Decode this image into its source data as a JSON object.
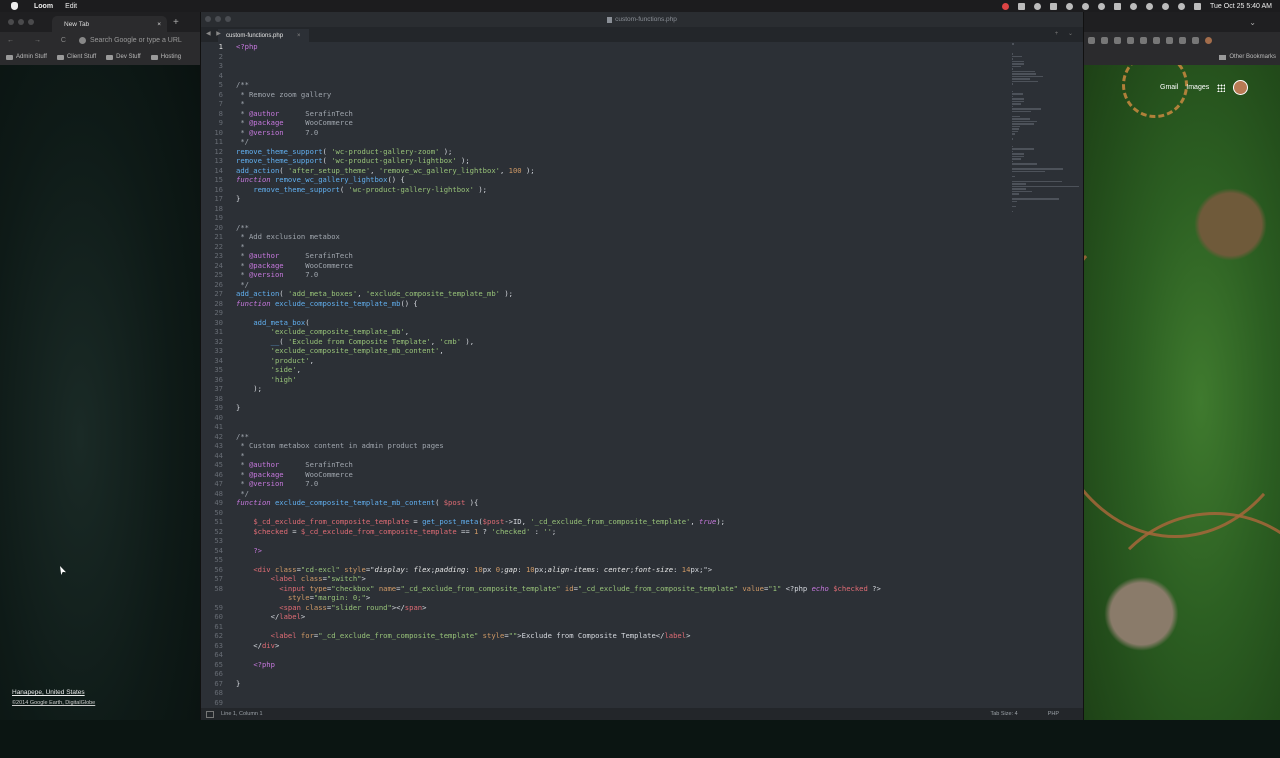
{
  "menubar": {
    "app_name": "Loom",
    "menu_edit": "Edit",
    "clock": "Tue Oct 25  5:40 AM"
  },
  "browser": {
    "tab_title": "New Tab",
    "tab_close": "×",
    "new_tab": "+",
    "nav_icons": "← → C",
    "address_placeholder": "Search Google or type a URL",
    "bookmarks": [
      "Admin Stuff",
      "Client Stuff",
      "Dev Stuff",
      "Hosting"
    ],
    "other_bookmarks": "Other Bookmarks",
    "google_links": {
      "gmail": "Gmail",
      "images": "Images"
    }
  },
  "wallpaper": {
    "location": "Hanapepe, United States",
    "copyright": "©2014 Google Earth, DigitalGlobe"
  },
  "editor": {
    "window_title": "custom-functions.php",
    "tab_label": "custom-functions.php",
    "tab_close": "×",
    "tab_arrows": "◀ ▶",
    "status_position": "Line 1, Column 1",
    "status_tab_size": "Tab Size: 4",
    "status_language": "PHP",
    "active_line": 1
  },
  "code_lines": [
    [
      [
        "tag",
        "<?php"
      ]
    ],
    [],
    [],
    [],
    [
      [
        "com",
        "/**"
      ]
    ],
    [
      [
        "com",
        " * Remove zoom gallery"
      ]
    ],
    [
      [
        "com",
        " *"
      ]
    ],
    [
      [
        "com",
        " * "
      ],
      [
        "tag",
        "@author"
      ],
      [
        "com",
        "      SerafinTech"
      ]
    ],
    [
      [
        "com",
        " * "
      ],
      [
        "tag",
        "@package"
      ],
      [
        "com",
        "     WooCommerce"
      ]
    ],
    [
      [
        "com",
        " * "
      ],
      [
        "tag",
        "@version"
      ],
      [
        "com",
        "     7.0"
      ]
    ],
    [
      [
        "com",
        " */"
      ]
    ],
    [
      [
        "fn",
        "remove_theme_support"
      ],
      [
        "txt",
        "( "
      ],
      [
        "str",
        "'wc-product-gallery-zoom'"
      ],
      [
        "txt",
        " );"
      ]
    ],
    [
      [
        "fn",
        "remove_theme_support"
      ],
      [
        "txt",
        "( "
      ],
      [
        "str",
        "'wc-product-gallery-lightbox'"
      ],
      [
        "txt",
        " );"
      ]
    ],
    [
      [
        "fn",
        "add_action"
      ],
      [
        "txt",
        "( "
      ],
      [
        "str",
        "'after_setup_theme'"
      ],
      [
        "txt",
        ", "
      ],
      [
        "str",
        "'remove_wc_gallery_lightbox'"
      ],
      [
        "txt",
        ", "
      ],
      [
        "num",
        "100"
      ],
      [
        "txt",
        " );"
      ]
    ],
    [
      [
        "kw",
        "function"
      ],
      [
        "txt",
        " "
      ],
      [
        "fn",
        "remove_wc_gallery_lightbox"
      ],
      [
        "txt",
        "() {"
      ]
    ],
    [
      [
        "txt",
        "    "
      ],
      [
        "fn",
        "remove_theme_support"
      ],
      [
        "txt",
        "( "
      ],
      [
        "str",
        "'wc-product-gallery-lightbox'"
      ],
      [
        "txt",
        " );"
      ]
    ],
    [
      [
        "txt",
        "}"
      ]
    ],
    [],
    [],
    [
      [
        "com",
        "/**"
      ]
    ],
    [
      [
        "com",
        " * Add exclusion metabox"
      ]
    ],
    [
      [
        "com",
        " *"
      ]
    ],
    [
      [
        "com",
        " * "
      ],
      [
        "tag",
        "@author"
      ],
      [
        "com",
        "      SerafinTech"
      ]
    ],
    [
      [
        "com",
        " * "
      ],
      [
        "tag",
        "@package"
      ],
      [
        "com",
        "     WooCommerce"
      ]
    ],
    [
      [
        "com",
        " * "
      ],
      [
        "tag",
        "@version"
      ],
      [
        "com",
        "     7.0"
      ]
    ],
    [
      [
        "com",
        " */"
      ]
    ],
    [
      [
        "fn",
        "add_action"
      ],
      [
        "txt",
        "( "
      ],
      [
        "str",
        "'add_meta_boxes'"
      ],
      [
        "txt",
        ", "
      ],
      [
        "str",
        "'exclude_composite_template_mb'"
      ],
      [
        "txt",
        " );"
      ]
    ],
    [
      [
        "kw",
        "function"
      ],
      [
        "txt",
        " "
      ],
      [
        "fn",
        "exclude_composite_template_mb"
      ],
      [
        "txt",
        "() {"
      ]
    ],
    [],
    [
      [
        "txt",
        "    "
      ],
      [
        "fn",
        "add_meta_box"
      ],
      [
        "txt",
        "("
      ]
    ],
    [
      [
        "txt",
        "        "
      ],
      [
        "str",
        "'exclude_composite_template_mb'"
      ],
      [
        "txt",
        ","
      ]
    ],
    [
      [
        "txt",
        "        "
      ],
      [
        "fn",
        "__"
      ],
      [
        "txt",
        "( "
      ],
      [
        "str",
        "'Exclude from Composite Template'"
      ],
      [
        "txt",
        ", "
      ],
      [
        "str",
        "'cmb'"
      ],
      [
        "txt",
        " ),"
      ]
    ],
    [
      [
        "txt",
        "        "
      ],
      [
        "str",
        "'exclude_composite_template_mb_content'"
      ],
      [
        "txt",
        ","
      ]
    ],
    [
      [
        "txt",
        "        "
      ],
      [
        "str",
        "'product'"
      ],
      [
        "txt",
        ","
      ]
    ],
    [
      [
        "txt",
        "        "
      ],
      [
        "str",
        "'side'"
      ],
      [
        "txt",
        ","
      ]
    ],
    [
      [
        "txt",
        "        "
      ],
      [
        "str",
        "'high'"
      ]
    ],
    [
      [
        "txt",
        "    );"
      ]
    ],
    [],
    [
      [
        "txt",
        "}"
      ]
    ],
    [],
    [],
    [
      [
        "com",
        "/**"
      ]
    ],
    [
      [
        "com",
        " * Custom metabox content in admin product pages"
      ]
    ],
    [
      [
        "com",
        " *"
      ]
    ],
    [
      [
        "com",
        " * "
      ],
      [
        "tag",
        "@author"
      ],
      [
        "com",
        "      SerafinTech"
      ]
    ],
    [
      [
        "com",
        " * "
      ],
      [
        "tag",
        "@package"
      ],
      [
        "com",
        "     WooCommerce"
      ]
    ],
    [
      [
        "com",
        " * "
      ],
      [
        "tag",
        "@version"
      ],
      [
        "com",
        "     7.0"
      ]
    ],
    [
      [
        "com",
        " */"
      ]
    ],
    [
      [
        "kw",
        "function"
      ],
      [
        "txt",
        " "
      ],
      [
        "fn",
        "exclude_composite_template_mb_content"
      ],
      [
        "txt",
        "( "
      ],
      [
        "var",
        "$post"
      ],
      [
        "txt",
        " ){"
      ]
    ],
    [],
    [
      [
        "txt",
        "    "
      ],
      [
        "var",
        "$_cd_exclude_from_composite_template"
      ],
      [
        "txt",
        " = "
      ],
      [
        "fn",
        "get_post_meta"
      ],
      [
        "txt",
        "("
      ],
      [
        "var",
        "$post"
      ],
      [
        "txt",
        "->ID, "
      ],
      [
        "str",
        "'_cd_exclude_from_composite_template'"
      ],
      [
        "txt",
        ", "
      ],
      [
        "kw",
        "true"
      ],
      [
        "txt",
        ");"
      ]
    ],
    [
      [
        "txt",
        "    "
      ],
      [
        "var",
        "$checked"
      ],
      [
        "txt",
        " = "
      ],
      [
        "var",
        "$_cd_exclude_from_composite_template"
      ],
      [
        "txt",
        " == "
      ],
      [
        "num",
        "1"
      ],
      [
        "txt",
        " ? "
      ],
      [
        "str",
        "'checked'"
      ],
      [
        "txt",
        " : "
      ],
      [
        "str",
        "''"
      ],
      [
        "txt",
        ";"
      ]
    ],
    [],
    [
      [
        "txt",
        "    "
      ],
      [
        "tag",
        "?>"
      ]
    ],
    [],
    [
      [
        "txt",
        "    "
      ],
      [
        "html",
        "<div"
      ],
      [
        "txt",
        " "
      ],
      [
        "attr",
        "class"
      ],
      [
        "txt",
        "="
      ],
      [
        "str",
        "\"cd-excl\""
      ],
      [
        "txt",
        " "
      ],
      [
        "attr",
        "style"
      ],
      [
        "txt",
        "=\""
      ],
      [
        "css",
        "display"
      ],
      [
        "txt",
        ": "
      ],
      [
        "css",
        "flex"
      ],
      [
        "txt",
        ";"
      ],
      [
        "css",
        "padding"
      ],
      [
        "txt",
        ": "
      ],
      [
        "num",
        "10"
      ],
      [
        "txt",
        "px "
      ],
      [
        "num",
        "0"
      ],
      [
        "txt",
        ";"
      ],
      [
        "css",
        "gap"
      ],
      [
        "txt",
        ": "
      ],
      [
        "num",
        "10"
      ],
      [
        "txt",
        "px;"
      ],
      [
        "css",
        "align-items"
      ],
      [
        "txt",
        ": "
      ],
      [
        "css",
        "center"
      ],
      [
        "txt",
        ";"
      ],
      [
        "css",
        "font-size"
      ],
      [
        "txt",
        ": "
      ],
      [
        "num",
        "14"
      ],
      [
        "txt",
        "px;\">"
      ]
    ],
    [
      [
        "txt",
        "        "
      ],
      [
        "html",
        "<label"
      ],
      [
        "txt",
        " "
      ],
      [
        "attr",
        "class"
      ],
      [
        "txt",
        "="
      ],
      [
        "str",
        "\"switch\""
      ],
      [
        "txt",
        ">"
      ]
    ],
    [
      [
        "txt",
        "          "
      ],
      [
        "html",
        "<input"
      ],
      [
        "txt",
        " "
      ],
      [
        "attr",
        "type"
      ],
      [
        "txt",
        "="
      ],
      [
        "str",
        "\"checkbox\""
      ],
      [
        "txt",
        " "
      ],
      [
        "attr",
        "name"
      ],
      [
        "txt",
        "="
      ],
      [
        "str",
        "\"_cd_exclude_from_composite_template\""
      ],
      [
        "txt",
        " "
      ],
      [
        "attr",
        "id"
      ],
      [
        "txt",
        "="
      ],
      [
        "str",
        "\"_cd_exclude_from_composite_template\""
      ],
      [
        "txt",
        " "
      ],
      [
        "attr",
        "value"
      ],
      [
        "txt",
        "="
      ],
      [
        "str",
        "\"1\""
      ],
      [
        "txt",
        " <?php "
      ],
      [
        "kw",
        "echo"
      ],
      [
        "txt",
        " "
      ],
      [
        "var",
        "$checked"
      ],
      [
        "txt",
        " ?>"
      ]
    ],
    [
      [
        "txt",
        "            "
      ],
      [
        "attr",
        "style"
      ],
      [
        "txt",
        "="
      ],
      [
        "str",
        "\"margin: 0;\""
      ],
      [
        "txt",
        ">"
      ]
    ],
    [
      [
        "txt",
        "          "
      ],
      [
        "html",
        "<span"
      ],
      [
        "txt",
        " "
      ],
      [
        "attr",
        "class"
      ],
      [
        "txt",
        "="
      ],
      [
        "str",
        "\"slider round\""
      ],
      [
        "txt",
        "></"
      ],
      [
        "html",
        "span"
      ],
      [
        "txt",
        ">"
      ]
    ],
    [
      [
        "txt",
        "        </"
      ],
      [
        "html",
        "label"
      ],
      [
        "txt",
        ">"
      ]
    ],
    [],
    [
      [
        "txt",
        "        "
      ],
      [
        "html",
        "<label"
      ],
      [
        "txt",
        " "
      ],
      [
        "attr",
        "for"
      ],
      [
        "txt",
        "="
      ],
      [
        "str",
        "\"_cd_exclude_from_composite_template\""
      ],
      [
        "txt",
        " "
      ],
      [
        "attr",
        "style"
      ],
      [
        "txt",
        "="
      ],
      [
        "str",
        "\"\""
      ],
      [
        "txt",
        ">Exclude from Composite Template</"
      ],
      [
        "html",
        "label"
      ],
      [
        "txt",
        ">"
      ]
    ],
    [
      [
        "txt",
        "    </"
      ],
      [
        "html",
        "div"
      ],
      [
        "txt",
        ">"
      ]
    ],
    [],
    [
      [
        "txt",
        "    "
      ],
      [
        "tag",
        "<?php"
      ]
    ],
    [],
    [
      [
        "txt",
        "}"
      ]
    ],
    [],
    []
  ],
  "line_numbers": [
    "1",
    "2",
    "3",
    "4",
    "5",
    "6",
    "7",
    "8",
    "9",
    "10",
    "11",
    "12",
    "13",
    "14",
    "15",
    "16",
    "17",
    "18",
    "19",
    "20",
    "21",
    "22",
    "23",
    "24",
    "25",
    "26",
    "27",
    "28",
    "29",
    "30",
    "31",
    "32",
    "33",
    "34",
    "35",
    "36",
    "37",
    "38",
    "39",
    "40",
    "41",
    "42",
    "43",
    "44",
    "45",
    "46",
    "47",
    "48",
    "49",
    "50",
    "51",
    "52",
    "53",
    "54",
    "55",
    "56",
    "57",
    "58",
    "",
    "59",
    "60",
    "61",
    "62",
    "63",
    "64",
    "65",
    "66",
    "67",
    "68",
    "69"
  ],
  "colors": {
    "editor_bg": "#2c3036",
    "comment": "#a0a6ae",
    "keyword": "#c678dd",
    "function": "#61afef",
    "string": "#98c379",
    "number": "#d19a66",
    "variable": "#e06c75"
  }
}
